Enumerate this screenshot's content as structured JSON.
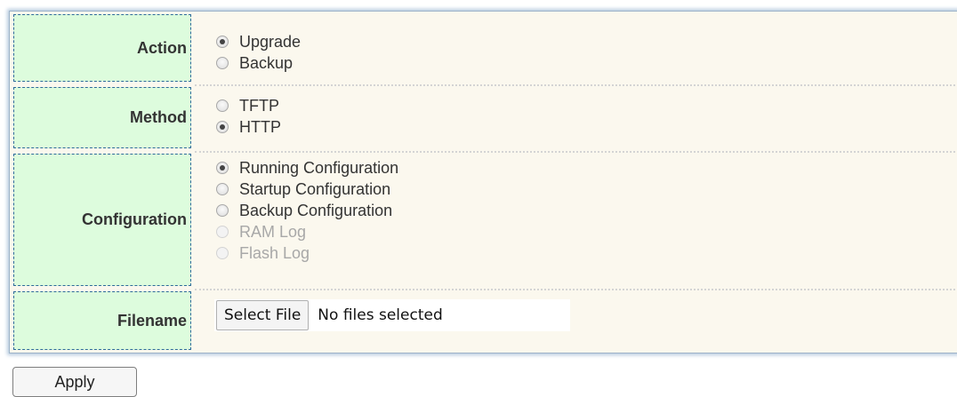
{
  "form": {
    "action": {
      "label": "Action",
      "options": [
        {
          "label": "Upgrade",
          "selected": true,
          "disabled": false
        },
        {
          "label": "Backup",
          "selected": false,
          "disabled": false
        }
      ]
    },
    "method": {
      "label": "Method",
      "options": [
        {
          "label": "TFTP",
          "selected": false,
          "disabled": false
        },
        {
          "label": "HTTP",
          "selected": true,
          "disabled": false
        }
      ]
    },
    "configuration": {
      "label": "Configuration",
      "options": [
        {
          "label": "Running Configuration",
          "selected": true,
          "disabled": false
        },
        {
          "label": "Startup Configuration",
          "selected": false,
          "disabled": false
        },
        {
          "label": "Backup Configuration",
          "selected": false,
          "disabled": false
        },
        {
          "label": "RAM Log",
          "selected": false,
          "disabled": true
        },
        {
          "label": "Flash Log",
          "selected": false,
          "disabled": true
        }
      ]
    },
    "filename": {
      "label": "Filename",
      "button_label": "Select File",
      "status": "No files selected"
    }
  },
  "apply_label": "Apply",
  "colors": {
    "label_bg": "#ddfcdd",
    "label_border": "#2e6b9a",
    "panel_bg": "#fbf8ee"
  }
}
